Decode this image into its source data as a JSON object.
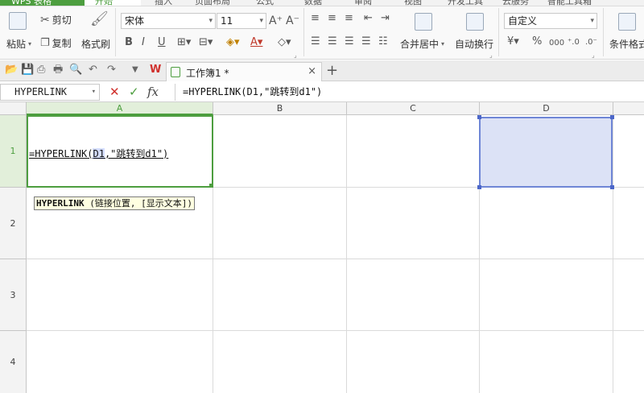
{
  "menubar": {
    "app_name": "WPS 表格",
    "active_tab": "开始",
    "tabs": [
      "插入",
      "页面布局",
      "公式",
      "数据",
      "审阅",
      "视图",
      "开发工具",
      "云服务",
      "智能工具箱"
    ]
  },
  "ribbon": {
    "paste_label": "粘贴",
    "cut_label": "剪切",
    "copy_label": "复制",
    "format_painter_label": "格式刷",
    "font_name": "宋体",
    "font_size": "11",
    "bold": "B",
    "italic": "I",
    "underline": "U",
    "merge_center_label": "合并居中",
    "wrap_text_label": "自动换行",
    "number_format": "自定义",
    "percent": "%",
    "comma": "000",
    "conditional_format_label": "条件格式"
  },
  "tabbar": {
    "document_title": "工作簿1 *",
    "close_glyph": "×",
    "add_glyph": "+"
  },
  "formula_bar": {
    "name_box": "HYPERLINK",
    "cancel_glyph": "✕",
    "confirm_glyph": "✓",
    "fx_label": "fx",
    "formula": "=HYPERLINK(D1,\"跳转到d1\")"
  },
  "grid": {
    "columns": [
      "A",
      "B",
      "C",
      "D"
    ],
    "rows": [
      "1",
      "2",
      "3",
      "4"
    ],
    "active_column": "A",
    "active_row": "1",
    "cell_a1": {
      "prefix": "=HYPERLINK(",
      "ref": "D1",
      "suffix": ",\"跳转到d1\")"
    },
    "tooltip": {
      "function_name": "HYPERLINK",
      "signature": " (链接位置, [显示文本])"
    }
  },
  "colors": {
    "accent_green": "#4d9e3f",
    "reference_fill": "#dce2f6",
    "reference_border": "#6f86d6",
    "tooltip_bg": "#ffffe1"
  }
}
